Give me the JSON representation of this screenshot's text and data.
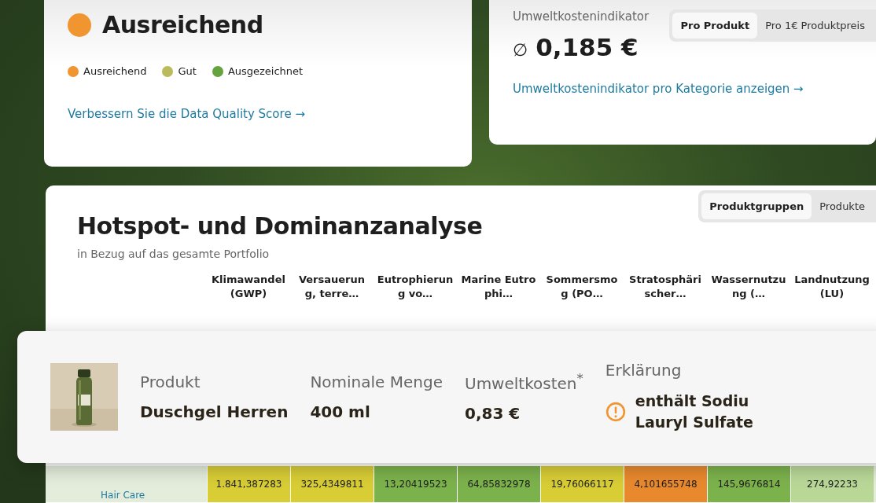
{
  "quality_card": {
    "rating": {
      "label": "Ausreichend",
      "color": "#f0952f"
    },
    "legend": [
      {
        "label": "Ausreichend",
        "color": "#f0952f"
      },
      {
        "label": "Gut",
        "color": "#b9bb5c"
      },
      {
        "label": "Ausgezeichnet",
        "color": "#64a33e"
      }
    ],
    "link": "Verbessern Sie die Data Quality Score →"
  },
  "cost_card": {
    "label": "Umweltkostenindikator",
    "average_sign": "∅",
    "value": "0,185 €",
    "tabs": [
      {
        "label": "Pro Produkt",
        "selected": true
      },
      {
        "label": "Pro 1€ Produktpreis",
        "selected": false
      }
    ],
    "link": "Umweltkostenindikator pro Kategorie anzeigen →"
  },
  "analysis": {
    "title": "Hotspot- und Dominanzanalyse",
    "subtitle": "in Bezug auf das gesamte Portfolio",
    "tabs": [
      {
        "label": "Produktgruppen",
        "selected": true
      },
      {
        "label": "Produkte",
        "selected": false
      }
    ],
    "columns": [
      "Klimawandel (GWP)",
      "Versauerung, terre…",
      "Eutrophierung vo…",
      "Marine Eutrophi…",
      "Sommersmog (PO…",
      "Stratosphärischer…",
      "Wassernutzung (…",
      "Landnutzung (LU)"
    ],
    "rows": [
      {
        "label": "Hair Care",
        "cells": [
          {
            "value": "1.841,387283",
            "color": "#d8cd35"
          },
          {
            "value": "325,4349811",
            "color": "#d8cd35"
          },
          {
            "value": "13,20419523",
            "color": "#7cb24c"
          },
          {
            "value": "64,85832978",
            "color": "#7cb24c"
          },
          {
            "value": "19,76066117",
            "color": "#d8cd35"
          },
          {
            "value": "4,101655748",
            "color": "#e8892e"
          },
          {
            "value": "145,9676814",
            "color": "#7cb24c"
          },
          {
            "value": "274,92233",
            "color": "#b9d898"
          }
        ]
      }
    ]
  },
  "product_card": {
    "fields": [
      {
        "label": "Produkt",
        "value": "Duschgel Herren"
      },
      {
        "label": "Nominale Menge",
        "value": "400 ml"
      },
      {
        "label": "Umweltkosten$^{*}$",
        "value": "0,83 €"
      }
    ],
    "explanation": {
      "label": "Erklärung",
      "lines": [
        "enthält Sodiu",
        "Lauryl Sulfate"
      ]
    }
  }
}
